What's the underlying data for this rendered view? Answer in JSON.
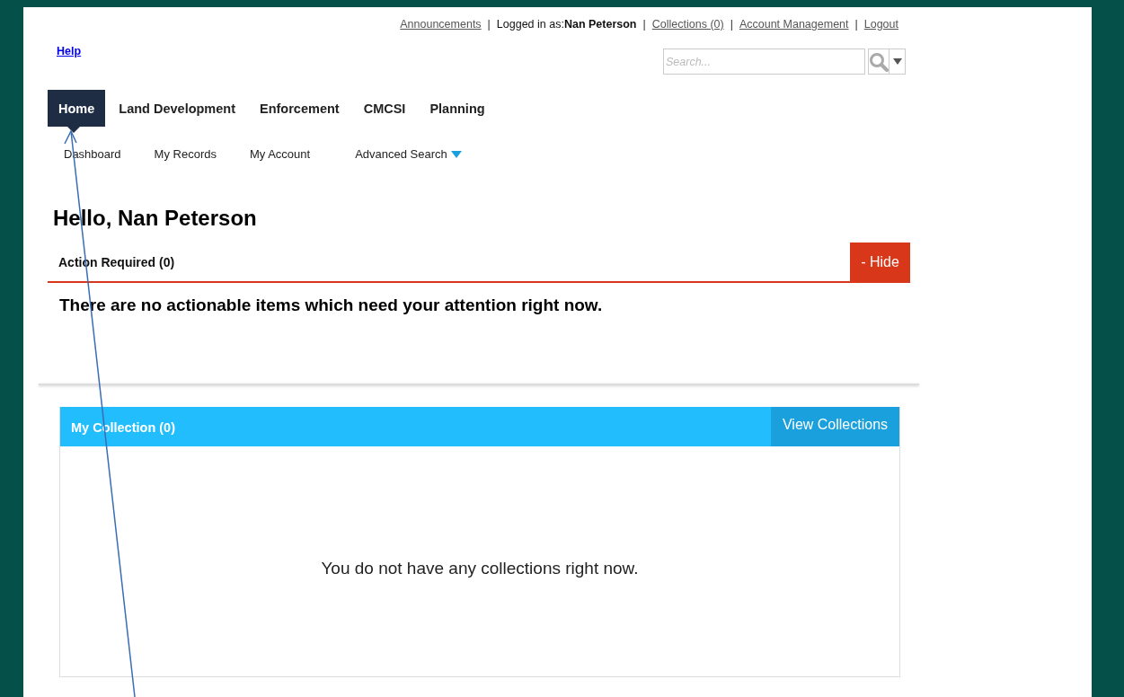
{
  "top_links": [
    {
      "kind": "link",
      "label": "Announcements"
    },
    {
      "kind": "user",
      "prefix": "Logged in as:",
      "name": "Nan Peterson"
    },
    {
      "kind": "link",
      "label": "Collections (0)"
    },
    {
      "kind": "link",
      "label": "Account Management"
    },
    {
      "kind": "link",
      "label": "Logout"
    }
  ],
  "top_separator": "|",
  "help": "Help",
  "search": {
    "placeholder": "Search..."
  },
  "tabs": [
    {
      "label": "Home",
      "selected": true
    },
    {
      "label": "Land Development",
      "selected": false
    },
    {
      "label": "Enforcement",
      "selected": false
    },
    {
      "label": "CMCSI",
      "selected": false
    },
    {
      "label": "Planning",
      "selected": false
    }
  ],
  "subnav": [
    {
      "label": "Dashboard",
      "dropdown": false
    },
    {
      "label": "My Records",
      "dropdown": false
    },
    {
      "label": "My Account",
      "dropdown": false
    },
    {
      "label": "Advanced Search",
      "dropdown": true
    }
  ],
  "greeting": "Hello, Nan Peterson",
  "action_required": {
    "title": "Action Required (0)",
    "button": "- Hide",
    "message": "There are no actionable items which need your attention right now."
  },
  "collection": {
    "title": "My Collection (0)",
    "button": "View Collections",
    "message": "You do not have any collections right now."
  }
}
